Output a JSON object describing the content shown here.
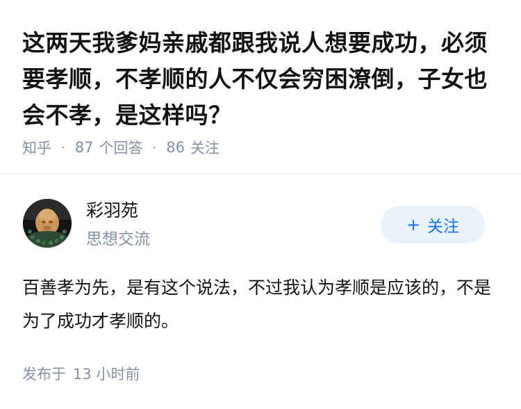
{
  "question": {
    "title": "这两天我爹妈亲戚都跟我说人想要成功，必须要孝顺，不孝顺的人不仅会穷困潦倒，子女也会不孝，是这样吗？"
  },
  "meta": {
    "source": "知乎",
    "separator": "·",
    "answer_count": "87",
    "answer_label": "个回答",
    "follower_count": "86",
    "follower_label": "关注"
  },
  "author": {
    "name": "彩羽苑",
    "bio": "思想交流",
    "avatar_icon": "avatar-photo"
  },
  "follow_button": {
    "plus": "+",
    "label": "关注",
    "color": "#1772f6",
    "background": "#e9f1fb"
  },
  "answer": {
    "text": "百善孝为先，是有这个说法，不过我认为孝顺是应该的，不是为了成功才孝顺的。"
  },
  "publish": {
    "label": "发布于",
    "time": "13 小时前"
  }
}
